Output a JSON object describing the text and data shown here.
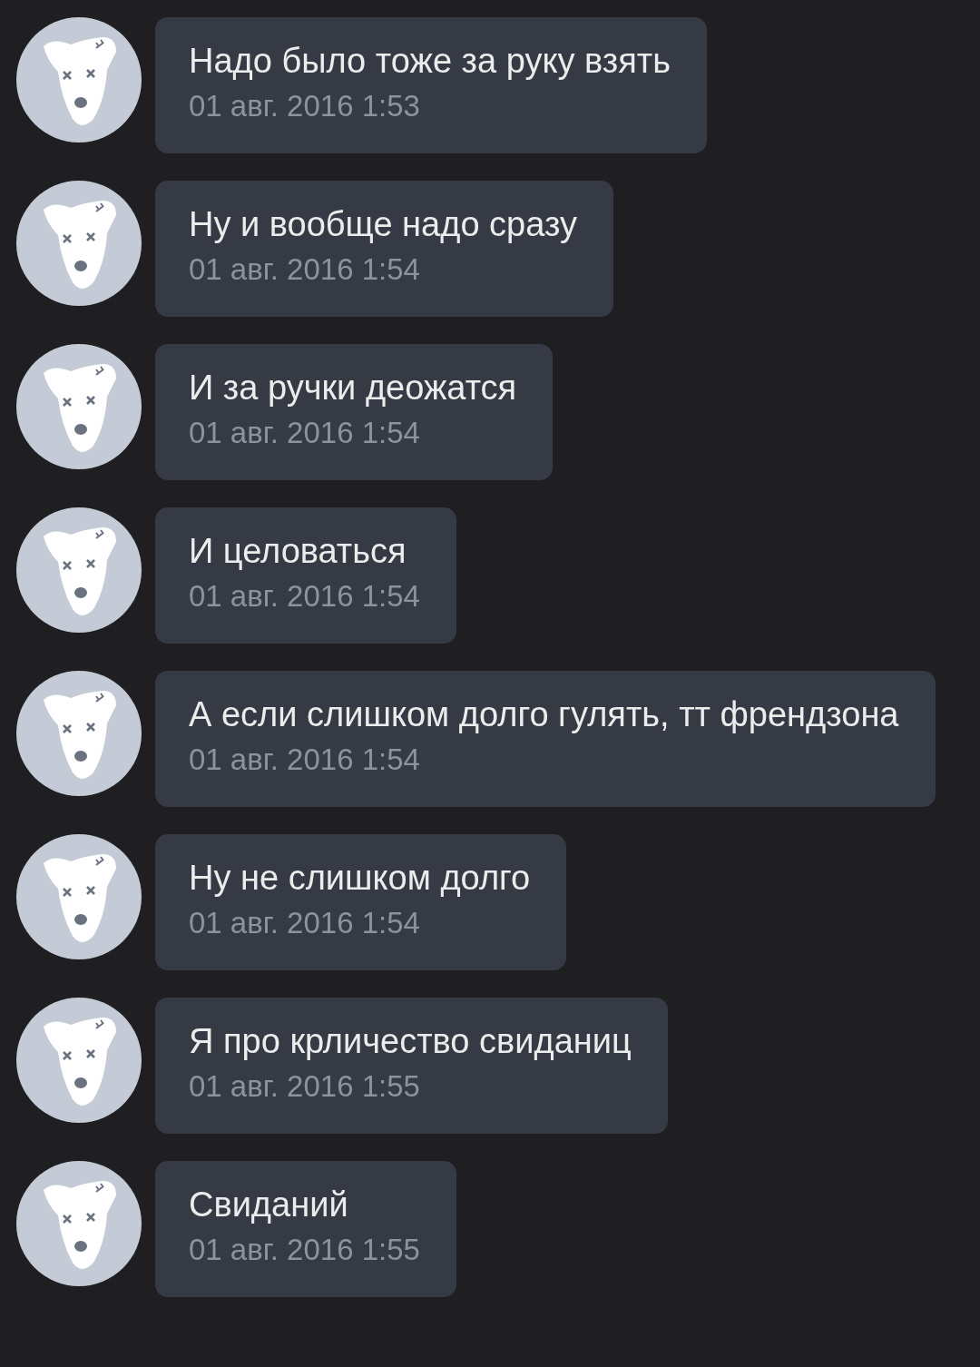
{
  "messages": [
    {
      "text": "Надо было тоже за руку взять",
      "time": "01 авг. 2016 1:53"
    },
    {
      "text": "Ну и вообще надо сразу",
      "time": "01 авг. 2016 1:54"
    },
    {
      "text": "И за ручки деожатся",
      "time": "01 авг. 2016 1:54"
    },
    {
      "text": "И целоваться",
      "time": "01 авг. 2016 1:54"
    },
    {
      "text": "А если слишком долго гулять, тт френдзона",
      "time": "01 авг. 2016 1:54"
    },
    {
      "text": "Ну не слишком долго",
      "time": "01 авг. 2016 1:54"
    },
    {
      "text": "Я про крличество свиданиц",
      "time": "01 авг. 2016 1:55"
    },
    {
      "text": "Свиданий",
      "time": "01 авг. 2016 1:55"
    }
  ]
}
